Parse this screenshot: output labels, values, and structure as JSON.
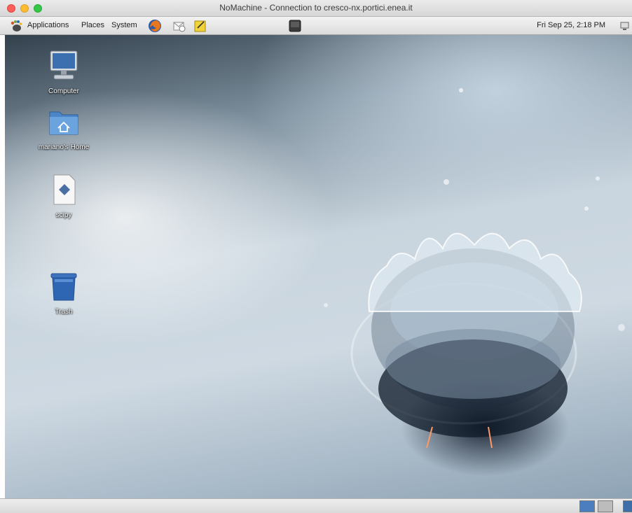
{
  "window": {
    "title": "NoMachine - Connection to cresco-nx.portici.enea.it"
  },
  "panel": {
    "menus": [
      "Applications",
      "Places",
      "System"
    ],
    "launchers": [
      "firefox-icon",
      "mail-icon",
      "notes-icon"
    ],
    "center_icon": "terminal-icon",
    "clock": "Fri Sep 25,  2:18 PM"
  },
  "desktop": {
    "icons": [
      {
        "label": "Computer",
        "icon": "computer-icon"
      },
      {
        "label": "mariano's Home",
        "icon": "home-folder-icon"
      },
      {
        "label": "scipy",
        "icon": "document-icon"
      },
      {
        "label": "Trash",
        "icon": "trash-icon"
      }
    ]
  },
  "bottom_panel": {
    "workspaces": 2
  },
  "colors": {
    "accent": "#4a7ebf",
    "close": "#fc5f57",
    "minimize": "#fdbc2e",
    "maximize": "#33c748"
  }
}
